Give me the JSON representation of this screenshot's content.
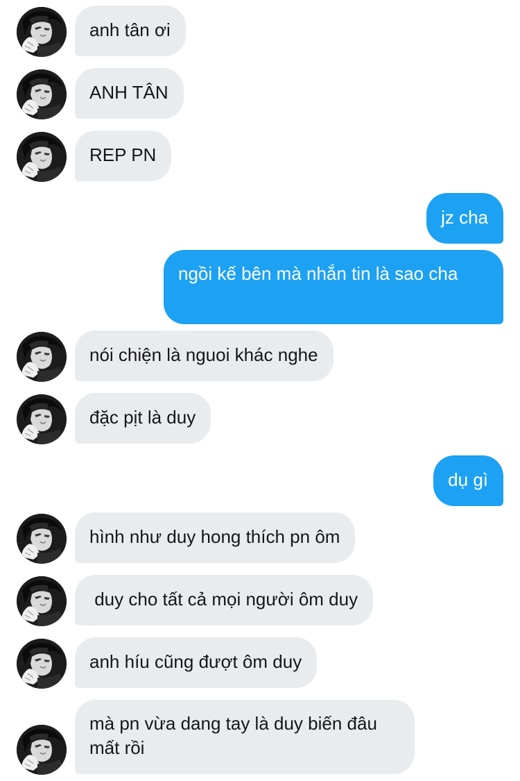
{
  "conversation": {
    "messages": [
      {
        "text": "anh tân ơi",
        "side": "received",
        "avatar": "profile-photo"
      },
      {
        "text": "ANH TÂN",
        "side": "received",
        "avatar": "profile-photo"
      },
      {
        "text": "REP PN",
        "side": "received",
        "avatar": "profile-photo"
      },
      {
        "text": "jz cha",
        "side": "sent"
      },
      {
        "text": "ngồi kế bên mà nhắn tin là sao cha",
        "side": "sent"
      },
      {
        "text": "nói chiện là nguoi khác nghe",
        "side": "received",
        "avatar": "profile-photo"
      },
      {
        "text": "đặc pịt là duy",
        "side": "received",
        "avatar": "profile-photo"
      },
      {
        "text": "dụ gì",
        "side": "sent"
      },
      {
        "text": "hình như duy hong thích pn ôm",
        "side": "received",
        "avatar": "profile-photo"
      },
      {
        "text": " duy cho tất cả mọi người ôm duy",
        "side": "received",
        "avatar": "profile-photo"
      },
      {
        "text": "anh híu cũng đượt ôm duy",
        "side": "received",
        "avatar": "profile-photo"
      },
      {
        "text": "mà pn vừa dang tay là duy biến đâu mất rồi",
        "side": "received",
        "avatar": "profile-photo"
      }
    ]
  },
  "colors": {
    "received_bubble": "#e9ecef",
    "received_text": "#161616",
    "sent_bubble": "#1da1f2",
    "sent_text": "#ffffff",
    "background": "#ffffff"
  }
}
